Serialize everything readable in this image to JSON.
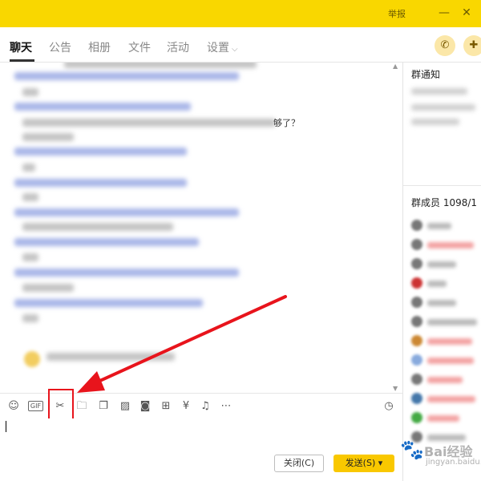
{
  "window": {
    "title": "",
    "report_label": "举报",
    "minimize_glyph": "—",
    "close_glyph": "✕"
  },
  "tabs": [
    {
      "label": "聊天",
      "active": true
    },
    {
      "label": "公告"
    },
    {
      "label": "相册"
    },
    {
      "label": "文件"
    },
    {
      "label": "活动"
    },
    {
      "label": "设置"
    }
  ],
  "header_icons": {
    "phone": "phone-icon",
    "add_app": "add-app-icon"
  },
  "chat": {
    "visible_fragment": "够了？"
  },
  "right_panel": {
    "notice_title": "群通知",
    "members_title": "群成员 1098/1"
  },
  "toolbar": {
    "tools": [
      "emoji-icon",
      "gif-icon",
      "scissors-icon",
      "folder-icon",
      "sticker-icon",
      "image-icon",
      "camera-icon",
      "gift-icon",
      "red-packet-icon",
      "bell-icon",
      "more-icon",
      "history-icon"
    ],
    "gif_label": "GIF"
  },
  "bottom": {
    "close_label": "关闭(C)",
    "send_label": "发送(S)",
    "send_dropdown_glyph": "▾"
  },
  "watermark": {
    "brand": "Bai经验",
    "url": "jingyan.baidu.com"
  },
  "colors": {
    "accent": "#f9d700",
    "send_button": "#f9c800",
    "annotation_red": "#e8141c"
  }
}
